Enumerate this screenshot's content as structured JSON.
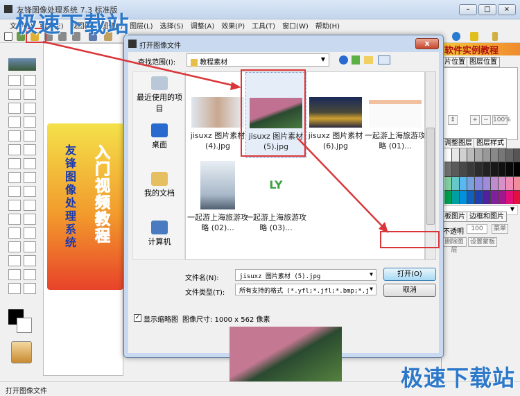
{
  "app": {
    "title": "友锋图像处理系统 7.3 标准版",
    "window_controls": [
      "minimize",
      "maximize",
      "close"
    ]
  },
  "menu": [
    "文件(F)",
    "编辑(E)",
    "视图(V)",
    "图像(I)",
    "图层(L)",
    "选择(S)",
    "调整(A)",
    "效果(P)",
    "工具(T)",
    "窗口(W)",
    "帮助(H)"
  ],
  "promo": {
    "line1": "友锋图像处理系统",
    "line2": "入门视频教程"
  },
  "right_panel": {
    "banner": "软件实例教程",
    "tabs1": [
      "片位置",
      "图层位置"
    ],
    "zoom_value": "100%",
    "tabs2": [
      "调整图层",
      "图层样式"
    ],
    "tabs3": [
      "板图片",
      "边框和图片"
    ],
    "opacity_label": "不透明",
    "opacity_value": "100",
    "menu_btn": "菜单",
    "btn_a": "删除图层",
    "btn_b": "设置蒙板"
  },
  "swatch_colors": [
    "#ffffff",
    "#e6e6e6",
    "#d0d0d0",
    "#bbbbbb",
    "#a8a8a8",
    "#999999",
    "#888888",
    "#777777",
    "#666666",
    "#555555",
    "#707070",
    "#5a5a5a",
    "#484848",
    "#3a3a3a",
    "#2c2c2c",
    "#222222",
    "#181818",
    "#101010",
    "#080808",
    "#000000",
    "#7fd1a0",
    "#66c8c8",
    "#5ab8f0",
    "#7aa0e0",
    "#8c8ce0",
    "#a08cd8",
    "#c08cd0",
    "#d890c8",
    "#f08cb8",
    "#f08c9c",
    "#00a050",
    "#00a0a0",
    "#0090e0",
    "#1060c0",
    "#2040b0",
    "#5020a0",
    "#8020a0",
    "#a01890",
    "#e0107a",
    "#e01040"
  ],
  "dialog": {
    "title": "打开图像文件",
    "close": "x",
    "look_in_label": "查找范围(I):",
    "look_in_value": "教程素材",
    "places": [
      "最近使用的项目",
      "桌面",
      "我的文档",
      "计算机"
    ],
    "files": [
      {
        "name": "jisuxz 图片素材 (4).jpg"
      },
      {
        "name": "jisuxz 图片素材 (5).jpg",
        "selected": true
      },
      {
        "name": "jisuxz 图片素材 (6).jpg"
      },
      {
        "name": "一起游上海旅游攻略 (01)..."
      },
      {
        "name": "一起游上海旅游攻略 (02)..."
      },
      {
        "name": "一起游上海旅游攻略 (03)..."
      }
    ],
    "filename_label": "文件名(N):",
    "filename_value": "jisuxz 图片素材 (5).jpg",
    "filetype_label": "文件类型(T):",
    "filetype_value": "所有支持的格式 (*.yfl;*.jfl;*.bmp;*.j",
    "open_btn": "打开(O)",
    "cancel_btn": "取消",
    "show_thumb": "显示缩略图",
    "show_thumb_checked": true,
    "image_size": "图像尺寸: 1000 x 562 像素"
  },
  "status": "打开图像文件",
  "watermark": "极速下载站",
  "accent": "#d9363a"
}
